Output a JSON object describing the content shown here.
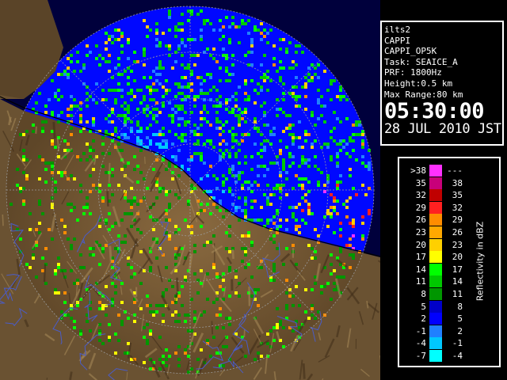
{
  "info": {
    "site": "ilts2",
    "product": "CAPPI",
    "product_id": "CAPPI_OP5K",
    "task": "Task: SEAICE_A",
    "prf": "PRF: 1800Hz",
    "height": "Height:0.5 km",
    "max_range": "Max Range:80 km",
    "time": "05:30:00",
    "date": "28 JUL 2010 JST"
  },
  "legend": {
    "unit_label": "Reflectivity in dBZ",
    "rows": [
      {
        "lo": ">38",
        "hi": "---",
        "color": "#ff30ff"
      },
      {
        "lo": "35",
        "hi": "38",
        "color": "#c8007a"
      },
      {
        "lo": "32",
        "hi": "35",
        "color": "#c00000"
      },
      {
        "lo": "29",
        "hi": "32",
        "color": "#ff2020"
      },
      {
        "lo": "26",
        "hi": "29",
        "color": "#ff8c00"
      },
      {
        "lo": "23",
        "hi": "26",
        "color": "#ffa800"
      },
      {
        "lo": "20",
        "hi": "23",
        "color": "#ffd000"
      },
      {
        "lo": "17",
        "hi": "20",
        "color": "#ffff00"
      },
      {
        "lo": "14",
        "hi": "17",
        "color": "#00ff00"
      },
      {
        "lo": "11",
        "hi": "14",
        "color": "#00c800"
      },
      {
        "lo": "8",
        "hi": "11",
        "color": "#009600"
      },
      {
        "lo": "5",
        "hi": "8",
        "color": "#0000c8"
      },
      {
        "lo": "2",
        "hi": "5",
        "color": "#0000ff"
      },
      {
        "lo": "-1",
        "hi": "2",
        "color": "#2080ff"
      },
      {
        "lo": "-4",
        "hi": "-1",
        "color": "#00c8ff"
      },
      {
        "lo": "-7",
        "hi": "-4",
        "color": "#00ffff"
      }
    ]
  },
  "colors": {
    "sea": "#0000ff",
    "land": "#7a5e3a",
    "coastline": "#000000",
    "rivers": "#4a5cc8",
    "range_rings": "#9a9a9a"
  }
}
